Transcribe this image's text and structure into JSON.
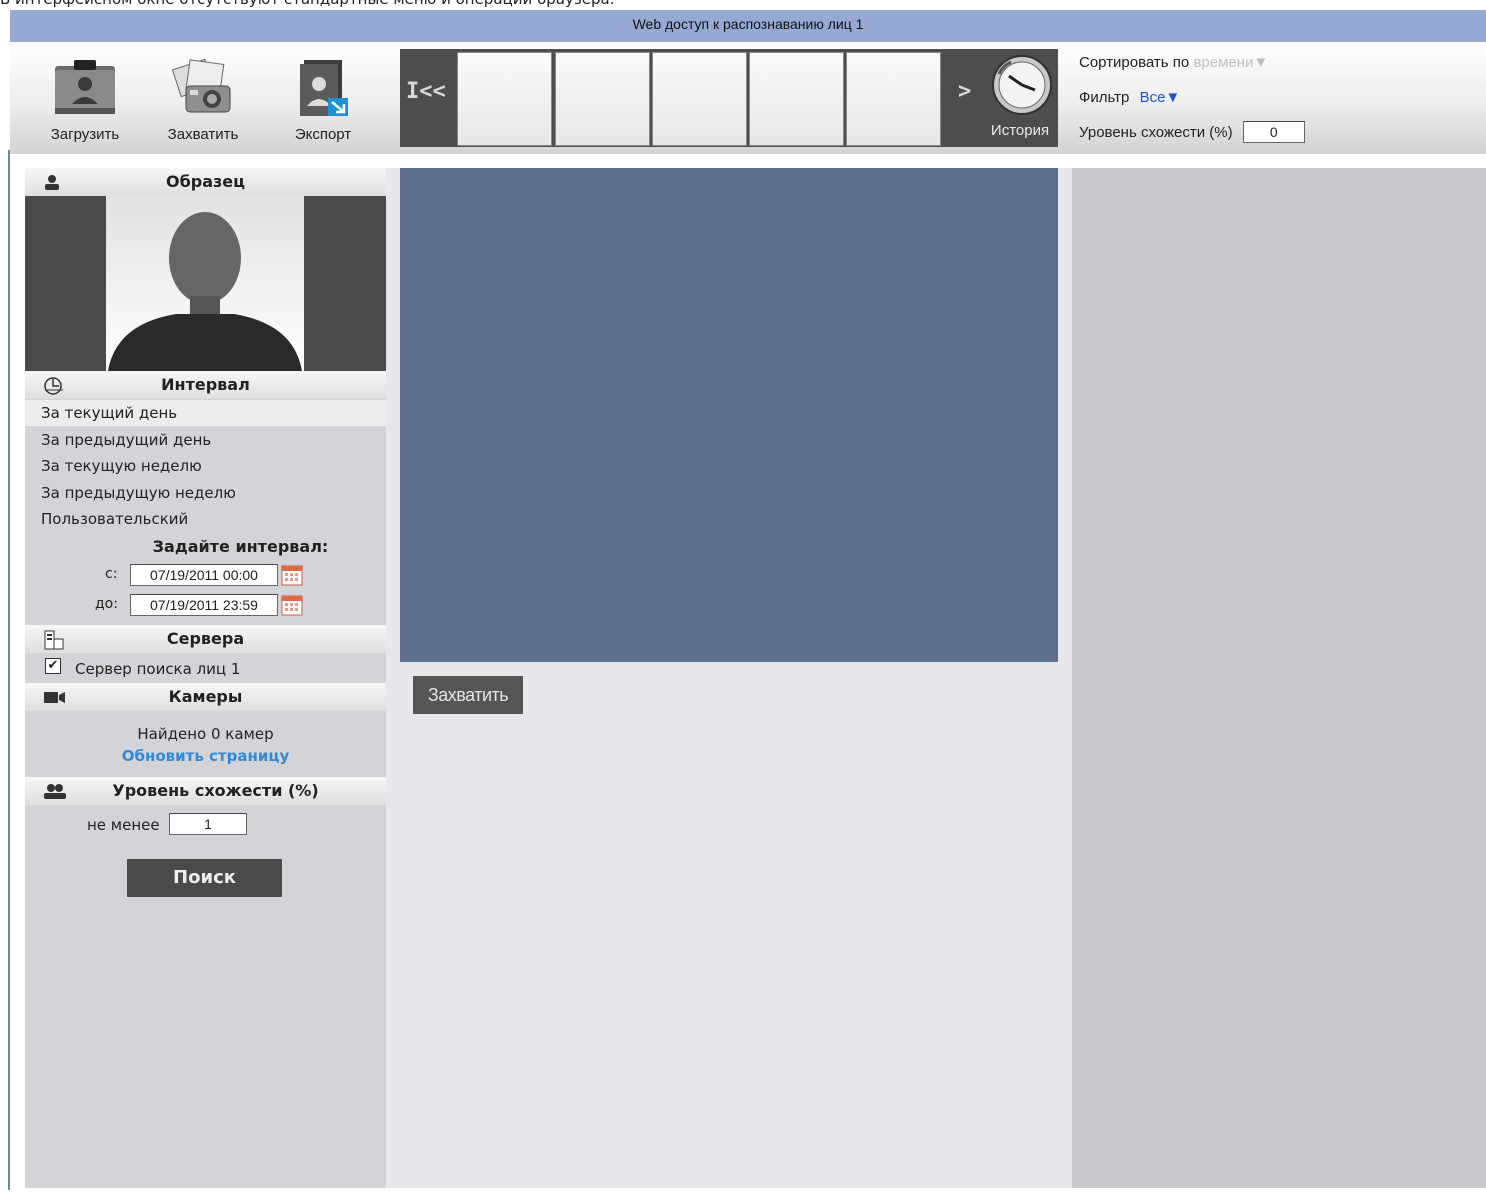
{
  "caption": "В интерфейсном окне отсутствуют стандартные меню и операции браузера.",
  "window": {
    "title": "Web доступ к распознаванию лиц 1"
  },
  "toolbar": {
    "upload_label": "Загрузить",
    "capture_label": "Захватить",
    "export_label": "Экспорт",
    "history_label": "История",
    "nav_first": "I<<",
    "nav_next": ">"
  },
  "right_controls": {
    "sort_label": "Сортировать по",
    "sort_value": "времени▼",
    "filter_label": "Фильтр",
    "filter_value": "Все▼",
    "similarity_label": "Уровень схожести (%)",
    "similarity_value": "0"
  },
  "sidebar": {
    "sample_title": "Образец",
    "interval_title": "Интервал",
    "interval_items": [
      "За текущий день",
      "За предыдущий день",
      "За текущую неделю",
      "За предыдущую неделю",
      "Пользовательский"
    ],
    "interval_selected_index": 0,
    "set_interval_label": "Задайте интервал:",
    "from_label": "с:",
    "from_value": "07/19/2011 00:00",
    "to_label": "до:",
    "to_value": "07/19/2011 23:59",
    "servers_title": "Сервера",
    "server_item": "Сервер поиска лиц 1",
    "server_checked": true,
    "cameras_title": "Камеры",
    "cameras_found": "Найдено 0 камер",
    "refresh_link": "Обновить страницу",
    "similarity_title": "Уровень схожести (%)",
    "min_label": "не менее",
    "min_value": "1",
    "search_button": "Поиск"
  },
  "main": {
    "capture_button": "Захватить"
  },
  "colors": {
    "titlebar": "#96a9d4",
    "video_area": "#5e6f8e",
    "link_blue": "#1e56c8",
    "refresh_link": "#2f8ad8"
  }
}
